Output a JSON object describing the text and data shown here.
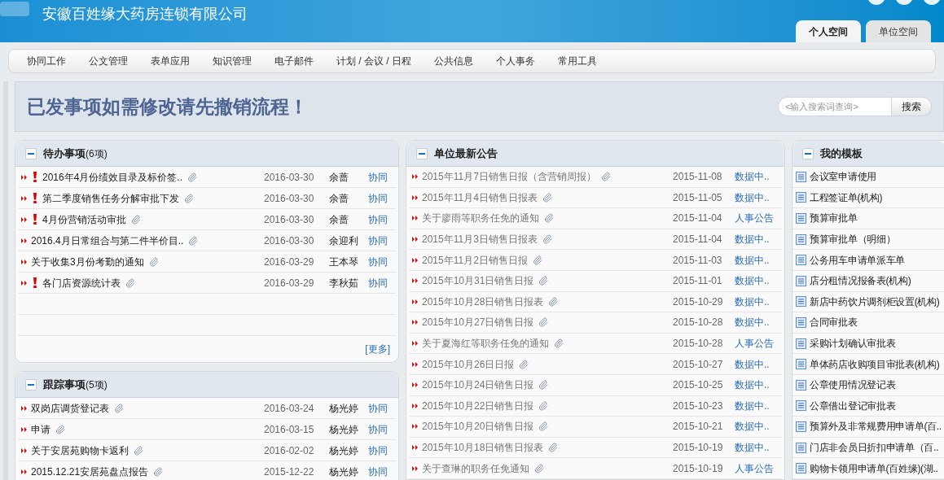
{
  "header": {
    "title": "安徽百姓缘大药房连锁有限公司"
  },
  "tabs": [
    {
      "label": "个人空间",
      "selected": true
    },
    {
      "label": "单位空间",
      "selected": false
    }
  ],
  "nav": [
    "协同工作",
    "公文管理",
    "表单应用",
    "知识管理",
    "电子邮件",
    "计划 / 会议 / 日程",
    "公共信息",
    "个人事务",
    "常用工具"
  ],
  "banner": {
    "message": "已发事项如需修改请先撤销流程！",
    "search_placeholder": "<输入搜索词查询>",
    "search_button": "搜索"
  },
  "todo": {
    "title": "待办事项",
    "count": "(6项)",
    "more": "[更多]",
    "rows": [
      {
        "title": "2016年4月份绩效目录及标价签..",
        "urgent": true,
        "date": "2016-03-30",
        "person": "余蔷",
        "category": "协同"
      },
      {
        "title": "第二季度销售任务分解审批下发",
        "urgent": true,
        "date": "2016-03-30",
        "person": "余蔷",
        "category": "协同"
      },
      {
        "title": "4月份营销活动审批",
        "urgent": true,
        "date": "2016-03-30",
        "person": "余蔷",
        "category": "协同"
      },
      {
        "title": "2016.4月日常组合与第二件半价目..",
        "urgent": false,
        "date": "2016-03-30",
        "person": "余迎利",
        "category": "协同"
      },
      {
        "title": "关于收集3月份考勤的通知",
        "urgent": false,
        "date": "2016-03-29",
        "person": "王本琴",
        "category": "协同"
      },
      {
        "title": "各门店资源统计表",
        "urgent": true,
        "date": "2016-03-29",
        "person": "李秋茹",
        "category": "协同"
      }
    ]
  },
  "tracking": {
    "title": "跟踪事项",
    "count": "(5项)",
    "rows": [
      {
        "title": "双岗店调货登记表",
        "urgent": false,
        "date": "2016-03-24",
        "person": "杨光婷",
        "category": "协同"
      },
      {
        "title": "申请",
        "urgent": false,
        "date": "2016-03-15",
        "person": "杨光婷",
        "category": "协同"
      },
      {
        "title": "关于安居苑购物卡返利",
        "urgent": false,
        "date": "2016-02-02",
        "person": "杨光婷",
        "category": "协同"
      },
      {
        "title": "2015.12.21安居苑盘点报告",
        "urgent": false,
        "date": "2015-12-22",
        "person": "杨光婷",
        "category": "协同"
      }
    ]
  },
  "announcements": {
    "title": "单位最新公告",
    "rows": [
      {
        "title": "2015年11月7日销售日报（含营销周报）",
        "date": "2015-11-08",
        "category": "数据中.."
      },
      {
        "title": "2015年11月4日销售日报表",
        "date": "2015-11-05",
        "category": "数据中.."
      },
      {
        "title": "关于廖雨等职务任免的通知",
        "date": "2015-11-04",
        "category": "人事公告"
      },
      {
        "title": "2015年11月3日销售日报表",
        "date": "2015-11-04",
        "category": "数据中.."
      },
      {
        "title": "2015年11月2日销售日报",
        "date": "2015-11-03",
        "category": "数据中.."
      },
      {
        "title": "2015年10月31日销售日报",
        "date": "2015-11-01",
        "category": "数据中.."
      },
      {
        "title": "2015年10月28日销售日报表",
        "date": "2015-10-29",
        "category": "数据中.."
      },
      {
        "title": "2015年10月27日销售日报",
        "date": "2015-10-28",
        "category": "数据中.."
      },
      {
        "title": "关于夏海红等职务任免的通知",
        "date": "2015-10-28",
        "category": "人事公告"
      },
      {
        "title": "2015年10月26日日报",
        "date": "2015-10-27",
        "category": "数据中.."
      },
      {
        "title": "2015年10月24日销售日报",
        "date": "2015-10-25",
        "category": "数据中.."
      },
      {
        "title": "2015年10月22日销售日报",
        "date": "2015-10-23",
        "category": "数据中.."
      },
      {
        "title": "2015年10月20日销售日报",
        "date": "2015-10-21",
        "category": "数据中.."
      },
      {
        "title": "2015年10月18日销售日报表",
        "date": "2015-10-19",
        "category": "数据中.."
      },
      {
        "title": "关于查琳的职务任免通知",
        "date": "2015-10-19",
        "category": "人事公告"
      }
    ]
  },
  "templates": {
    "title": "我的模板",
    "items": [
      "会议室申请使用",
      "工程签证单(机构)",
      "预算审批单",
      "预算审批单（明细）",
      "公务用车申请单派车单",
      "店分租情况报备表(机构)",
      "新店中药饮片调剂柜设置(机构)",
      "合同审批表",
      "采购计划确认审批表",
      "单体药店收购项目审批表(机构)",
      "公章使用情况登记表",
      "公章借出登记审批表",
      "预算外及非常规费用申请单(百..",
      "门店非会员日折扣申请单（百..",
      "购物卡领用申请单(百姓缘)(湖.."
    ]
  }
}
